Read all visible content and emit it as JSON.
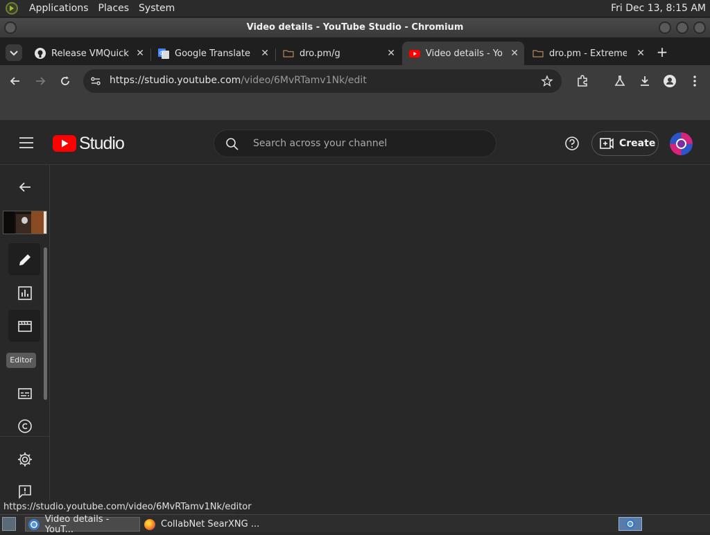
{
  "system_panel": {
    "menu_items": [
      "Applications",
      "Places",
      "System"
    ],
    "clock": "Fri Dec 13,  8:15 AM"
  },
  "window": {
    "title": "Video details - YouTube Studio - Chromium"
  },
  "tabs": [
    {
      "title": "Release VMQuickC",
      "icon": "github-icon",
      "active": false
    },
    {
      "title": "Google Translate",
      "icon": "google-translate-icon",
      "active": false
    },
    {
      "title": "dro.pm/g",
      "icon": "folder-icon",
      "active": false
    },
    {
      "title": "Video details - You",
      "icon": "youtube-icon",
      "active": true
    },
    {
      "title": "dro.pm - Extremely",
      "icon": "folder-icon",
      "active": false
    }
  ],
  "toolbar": {
    "url_host": "https://studio.youtube.com",
    "url_path": "/video/6MvRTamv1Nk/edit"
  },
  "studio": {
    "logo_text": "Studio",
    "search_placeholder": "Search across your channel",
    "create_label": "Create",
    "accent_color": "#ff0000"
  },
  "sidebar": {
    "tooltip": "Editor",
    "items": [
      "back-arrow-icon",
      "video-thumbnail",
      "details-pencil-icon",
      "analytics-icon",
      "editor-clapper-icon",
      "subtitles-icon",
      "copyright-icon",
      "settings-gear-icon",
      "feedback-icon"
    ]
  },
  "status_bar": {
    "hover_url": "https://studio.youtube.com/video/6MvRTamv1Nk/editor"
  },
  "taskbar": {
    "items": [
      {
        "label": "Video details - YouT...",
        "icon": "chromium-icon",
        "active": true
      },
      {
        "label": "CollabNet SearXNG ...",
        "icon": "firefox-icon",
        "active": false
      }
    ]
  }
}
